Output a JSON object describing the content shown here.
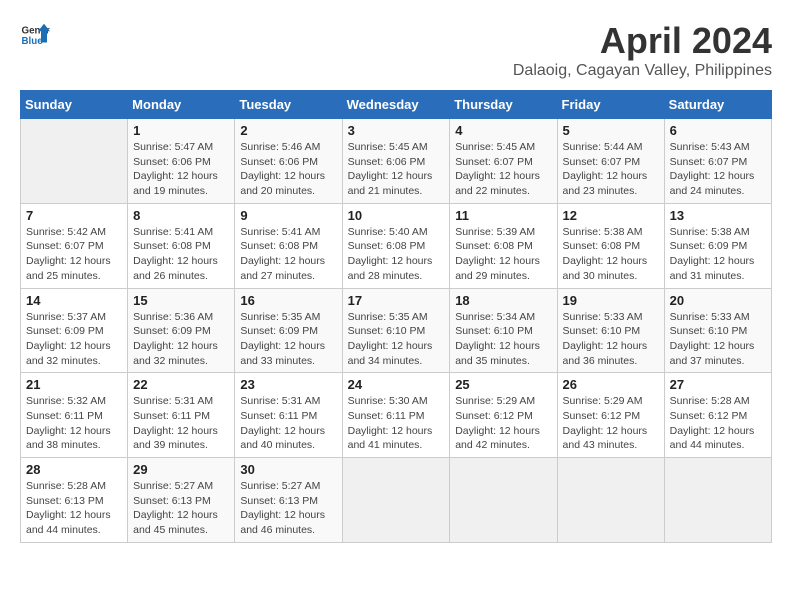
{
  "header": {
    "logo_general": "General",
    "logo_blue": "Blue",
    "title": "April 2024",
    "location": "Dalaoig, Cagayan Valley, Philippines"
  },
  "calendar": {
    "days_of_week": [
      "Sunday",
      "Monday",
      "Tuesday",
      "Wednesday",
      "Thursday",
      "Friday",
      "Saturday"
    ],
    "weeks": [
      [
        {
          "day": "",
          "detail": ""
        },
        {
          "day": "1",
          "detail": "Sunrise: 5:47 AM\nSunset: 6:06 PM\nDaylight: 12 hours\nand 19 minutes."
        },
        {
          "day": "2",
          "detail": "Sunrise: 5:46 AM\nSunset: 6:06 PM\nDaylight: 12 hours\nand 20 minutes."
        },
        {
          "day": "3",
          "detail": "Sunrise: 5:45 AM\nSunset: 6:06 PM\nDaylight: 12 hours\nand 21 minutes."
        },
        {
          "day": "4",
          "detail": "Sunrise: 5:45 AM\nSunset: 6:07 PM\nDaylight: 12 hours\nand 22 minutes."
        },
        {
          "day": "5",
          "detail": "Sunrise: 5:44 AM\nSunset: 6:07 PM\nDaylight: 12 hours\nand 23 minutes."
        },
        {
          "day": "6",
          "detail": "Sunrise: 5:43 AM\nSunset: 6:07 PM\nDaylight: 12 hours\nand 24 minutes."
        }
      ],
      [
        {
          "day": "7",
          "detail": "Sunrise: 5:42 AM\nSunset: 6:07 PM\nDaylight: 12 hours\nand 25 minutes."
        },
        {
          "day": "8",
          "detail": "Sunrise: 5:41 AM\nSunset: 6:08 PM\nDaylight: 12 hours\nand 26 minutes."
        },
        {
          "day": "9",
          "detail": "Sunrise: 5:41 AM\nSunset: 6:08 PM\nDaylight: 12 hours\nand 27 minutes."
        },
        {
          "day": "10",
          "detail": "Sunrise: 5:40 AM\nSunset: 6:08 PM\nDaylight: 12 hours\nand 28 minutes."
        },
        {
          "day": "11",
          "detail": "Sunrise: 5:39 AM\nSunset: 6:08 PM\nDaylight: 12 hours\nand 29 minutes."
        },
        {
          "day": "12",
          "detail": "Sunrise: 5:38 AM\nSunset: 6:08 PM\nDaylight: 12 hours\nand 30 minutes."
        },
        {
          "day": "13",
          "detail": "Sunrise: 5:38 AM\nSunset: 6:09 PM\nDaylight: 12 hours\nand 31 minutes."
        }
      ],
      [
        {
          "day": "14",
          "detail": "Sunrise: 5:37 AM\nSunset: 6:09 PM\nDaylight: 12 hours\nand 32 minutes."
        },
        {
          "day": "15",
          "detail": "Sunrise: 5:36 AM\nSunset: 6:09 PM\nDaylight: 12 hours\nand 32 minutes."
        },
        {
          "day": "16",
          "detail": "Sunrise: 5:35 AM\nSunset: 6:09 PM\nDaylight: 12 hours\nand 33 minutes."
        },
        {
          "day": "17",
          "detail": "Sunrise: 5:35 AM\nSunset: 6:10 PM\nDaylight: 12 hours\nand 34 minutes."
        },
        {
          "day": "18",
          "detail": "Sunrise: 5:34 AM\nSunset: 6:10 PM\nDaylight: 12 hours\nand 35 minutes."
        },
        {
          "day": "19",
          "detail": "Sunrise: 5:33 AM\nSunset: 6:10 PM\nDaylight: 12 hours\nand 36 minutes."
        },
        {
          "day": "20",
          "detail": "Sunrise: 5:33 AM\nSunset: 6:10 PM\nDaylight: 12 hours\nand 37 minutes."
        }
      ],
      [
        {
          "day": "21",
          "detail": "Sunrise: 5:32 AM\nSunset: 6:11 PM\nDaylight: 12 hours\nand 38 minutes."
        },
        {
          "day": "22",
          "detail": "Sunrise: 5:31 AM\nSunset: 6:11 PM\nDaylight: 12 hours\nand 39 minutes."
        },
        {
          "day": "23",
          "detail": "Sunrise: 5:31 AM\nSunset: 6:11 PM\nDaylight: 12 hours\nand 40 minutes."
        },
        {
          "day": "24",
          "detail": "Sunrise: 5:30 AM\nSunset: 6:11 PM\nDaylight: 12 hours\nand 41 minutes."
        },
        {
          "day": "25",
          "detail": "Sunrise: 5:29 AM\nSunset: 6:12 PM\nDaylight: 12 hours\nand 42 minutes."
        },
        {
          "day": "26",
          "detail": "Sunrise: 5:29 AM\nSunset: 6:12 PM\nDaylight: 12 hours\nand 43 minutes."
        },
        {
          "day": "27",
          "detail": "Sunrise: 5:28 AM\nSunset: 6:12 PM\nDaylight: 12 hours\nand 44 minutes."
        }
      ],
      [
        {
          "day": "28",
          "detail": "Sunrise: 5:28 AM\nSunset: 6:13 PM\nDaylight: 12 hours\nand 44 minutes."
        },
        {
          "day": "29",
          "detail": "Sunrise: 5:27 AM\nSunset: 6:13 PM\nDaylight: 12 hours\nand 45 minutes."
        },
        {
          "day": "30",
          "detail": "Sunrise: 5:27 AM\nSunset: 6:13 PM\nDaylight: 12 hours\nand 46 minutes."
        },
        {
          "day": "",
          "detail": ""
        },
        {
          "day": "",
          "detail": ""
        },
        {
          "day": "",
          "detail": ""
        },
        {
          "day": "",
          "detail": ""
        }
      ]
    ]
  }
}
